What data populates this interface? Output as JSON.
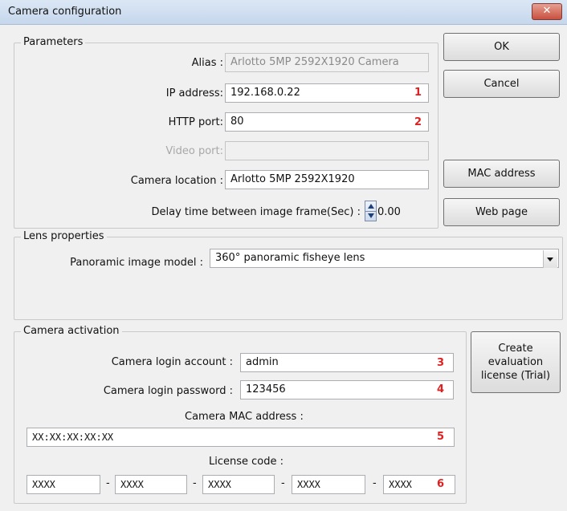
{
  "window": {
    "title": "Camera configuration",
    "close_glyph": "✕"
  },
  "parameters": {
    "legend": "Parameters",
    "alias_label": "Alias :",
    "alias_value": "Arlotto 5MP 2592X1920 Camera",
    "ip_label": "IP address:",
    "ip_value": "192.168.0.22",
    "ip_marker": "1",
    "http_label": "HTTP port:",
    "http_value": "80",
    "http_marker": "2",
    "video_label": "Video port:",
    "video_value": "",
    "location_label": "Camera location :",
    "location_value": "Arlotto 5MP 2592X1920",
    "delay_label": "Delay time between image frame(Sec) :",
    "delay_value": "0.00"
  },
  "buttons": {
    "ok": "OK",
    "cancel": "Cancel",
    "mac": "MAC address",
    "web": "Web page",
    "trial": "Create evaluation license (Trial)"
  },
  "lens": {
    "legend": "Lens properties",
    "model_label": "Panoramic image model :",
    "model_value": "360° panoramic fisheye lens"
  },
  "activation": {
    "legend": "Camera activation",
    "account_label": "Camera login account :",
    "account_value": "admin",
    "account_marker": "3",
    "password_label": "Camera login password :",
    "password_value": "123456",
    "password_marker": "4",
    "mac_label": "Camera MAC address :",
    "mac_value": "XX:XX:XX:XX:XX",
    "mac_marker": "5",
    "license_label": "License code :",
    "license_parts": [
      "XXXX",
      "XXXX",
      "XXXX",
      "XXXX",
      "XXXX"
    ],
    "license_marker": "6",
    "separator": "-"
  }
}
